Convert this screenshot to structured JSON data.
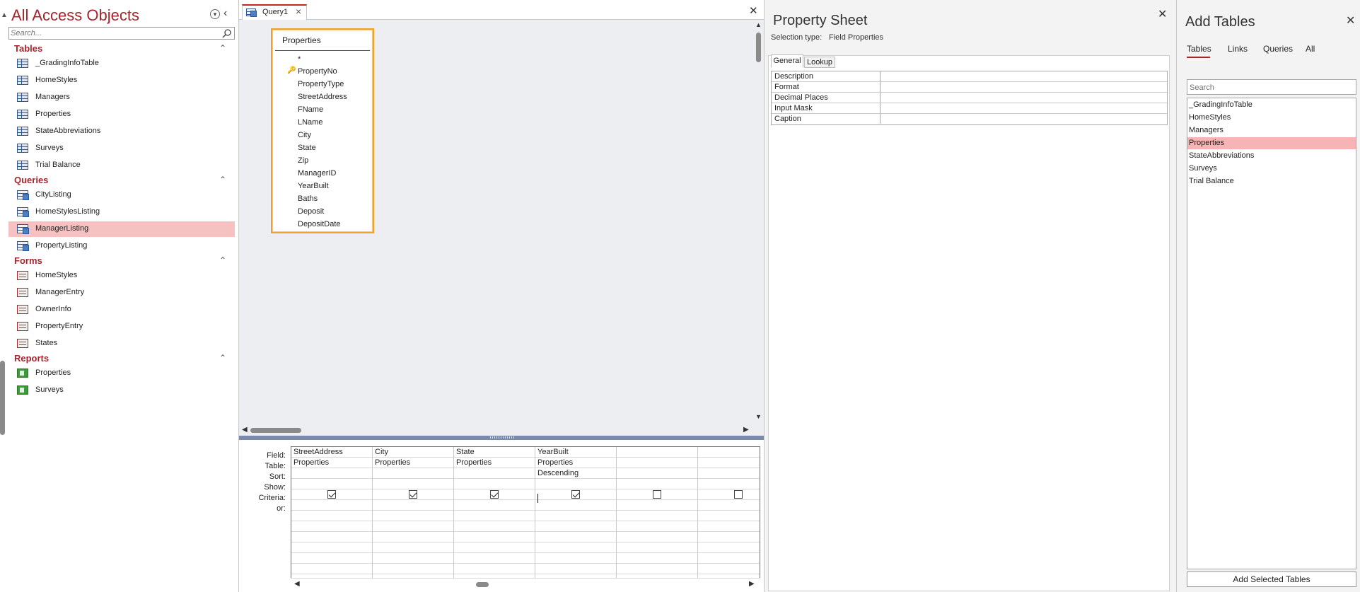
{
  "nav": {
    "title": "All Access Objects",
    "search_placeholder": "Search...",
    "groups": [
      {
        "name": "Tables",
        "items": [
          "_GradingInfoTable",
          "HomeStyles",
          "Managers",
          "Properties",
          "StateAbbreviations",
          "Surveys",
          "Trial Balance"
        ]
      },
      {
        "name": "Queries",
        "items": [
          "CityListing",
          "HomeStylesListing",
          "ManagerListing",
          "PropertyListing"
        ],
        "selected": "ManagerListing"
      },
      {
        "name": "Forms",
        "items": [
          "HomeStyles",
          "ManagerEntry",
          "OwnerInfo",
          "PropertyEntry",
          "States"
        ]
      },
      {
        "name": "Reports",
        "items": [
          "Properties",
          "Surveys"
        ]
      }
    ]
  },
  "document": {
    "tab_label": "Query1",
    "field_list": {
      "title": "Properties",
      "fields": [
        "*",
        "PropertyNo",
        "PropertyType",
        "StreetAddress",
        "FName",
        "LName",
        "City",
        "State",
        "Zip",
        "ManagerID",
        "YearBuilt",
        "Baths",
        "Deposit",
        "DepositDate"
      ],
      "primary_key": "PropertyNo"
    },
    "grid": {
      "row_labels": [
        "Field:",
        "Table:",
        "Sort:",
        "Show:",
        "Criteria:",
        "or:"
      ],
      "columns": [
        {
          "field": "StreetAddress",
          "table": "Properties",
          "sort": "",
          "show": true
        },
        {
          "field": "City",
          "table": "Properties",
          "sort": "",
          "show": true
        },
        {
          "field": "State",
          "table": "Properties",
          "sort": "",
          "show": true
        },
        {
          "field": "YearBuilt",
          "table": "Properties",
          "sort": "Descending",
          "show": true
        },
        {
          "field": "",
          "table": "",
          "sort": "",
          "show": false
        },
        {
          "field": "",
          "table": "",
          "sort": "",
          "show": false
        }
      ]
    }
  },
  "property_sheet": {
    "title": "Property Sheet",
    "selection_type_label": "Selection type:",
    "selection_type_value": "Field Properties",
    "tabs": [
      "General",
      "Lookup"
    ],
    "active_tab": "General",
    "properties": [
      "Description",
      "Format",
      "Decimal Places",
      "Input Mask",
      "Caption"
    ]
  },
  "add_tables": {
    "title": "Add Tables",
    "tabs": [
      "Tables",
      "Links",
      "Queries",
      "All"
    ],
    "active_tab": "Tables",
    "search_placeholder": "Search",
    "items": [
      "_GradingInfoTable",
      "HomeStyles",
      "Managers",
      "Properties",
      "StateAbbreviations",
      "Surveys",
      "Trial Balance"
    ],
    "selected": "Properties",
    "add_button": "Add Selected Tables"
  },
  "colors": {
    "accent": "#a4262c",
    "selection": "#f7c1c1",
    "field_list_border": "#f0a030"
  }
}
